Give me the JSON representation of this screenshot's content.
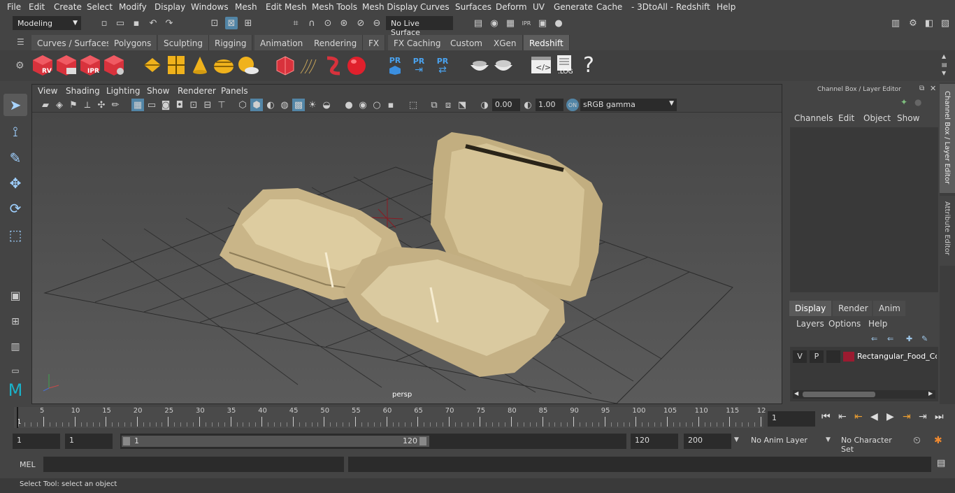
{
  "menubar": {
    "items": [
      "File",
      "Edit",
      "Create",
      "Select",
      "Modify",
      "Display",
      "Windows",
      "Mesh",
      "Edit Mesh",
      "Mesh Tools",
      "Mesh Display",
      "Curves",
      "Surfaces",
      "Deform",
      "UV",
      "Generate",
      "Cache",
      "- 3DtoAll -",
      "Redshift",
      "Help"
    ]
  },
  "statusline": {
    "mode": "Modeling",
    "live_surface": "No Live Surface"
  },
  "shelf": {
    "tabs": [
      "Curves / Surfaces",
      "Polygons",
      "Sculpting",
      "Rigging",
      "Animation",
      "Rendering",
      "FX",
      "FX Caching",
      "Custom",
      "XGen",
      "Redshift"
    ],
    "active_tab": "Redshift",
    "icon_labels": [
      "RV",
      "IPR",
      "PR",
      "PR",
      "PR",
      ".LOG",
      "?"
    ]
  },
  "viewport": {
    "menu": [
      "View",
      "Shading",
      "Lighting",
      "Show",
      "Renderer",
      "Panels"
    ],
    "exposure": "0.00",
    "gamma": "1.00",
    "color_space": "sRGB gamma",
    "camera_label": "persp"
  },
  "channel_box": {
    "title": "Channel Box / Layer Editor",
    "menu": [
      "Channels",
      "Edit",
      "Object",
      "Show"
    ]
  },
  "layer_editor": {
    "tabs": [
      "Display",
      "Render",
      "Anim"
    ],
    "active_tab": "Display",
    "menu": [
      "Layers",
      "Options",
      "Help"
    ],
    "layers": [
      {
        "v": "V",
        "p": "P",
        "name": "Rectangular_Food_Co",
        "color": "#9b1b30"
      }
    ]
  },
  "side_tabs": [
    "Channel Box / Layer Editor",
    "Attribute Editor"
  ],
  "timeline": {
    "ticks": [
      "5",
      "10",
      "15",
      "20",
      "25",
      "30",
      "35",
      "40",
      "45",
      "50",
      "55",
      "60",
      "65",
      "70",
      "75",
      "80",
      "85",
      "90",
      "95",
      "100",
      "105",
      "110",
      "115",
      "12"
    ],
    "start_label": "1",
    "current_frame": "1"
  },
  "range": {
    "start": "1",
    "playback_start": "1",
    "slider_start": "1",
    "slider_end": "120",
    "playback_end": "120",
    "end": "200",
    "anim_layer": "No Anim Layer",
    "character_set": "No Character Set"
  },
  "command": {
    "label": "MEL"
  },
  "help": {
    "text": "Select Tool: select an object"
  },
  "colors": {
    "accent": "#5285a6",
    "layer_color": "#9b1b30",
    "active_highlight": "#5d5d5d"
  }
}
